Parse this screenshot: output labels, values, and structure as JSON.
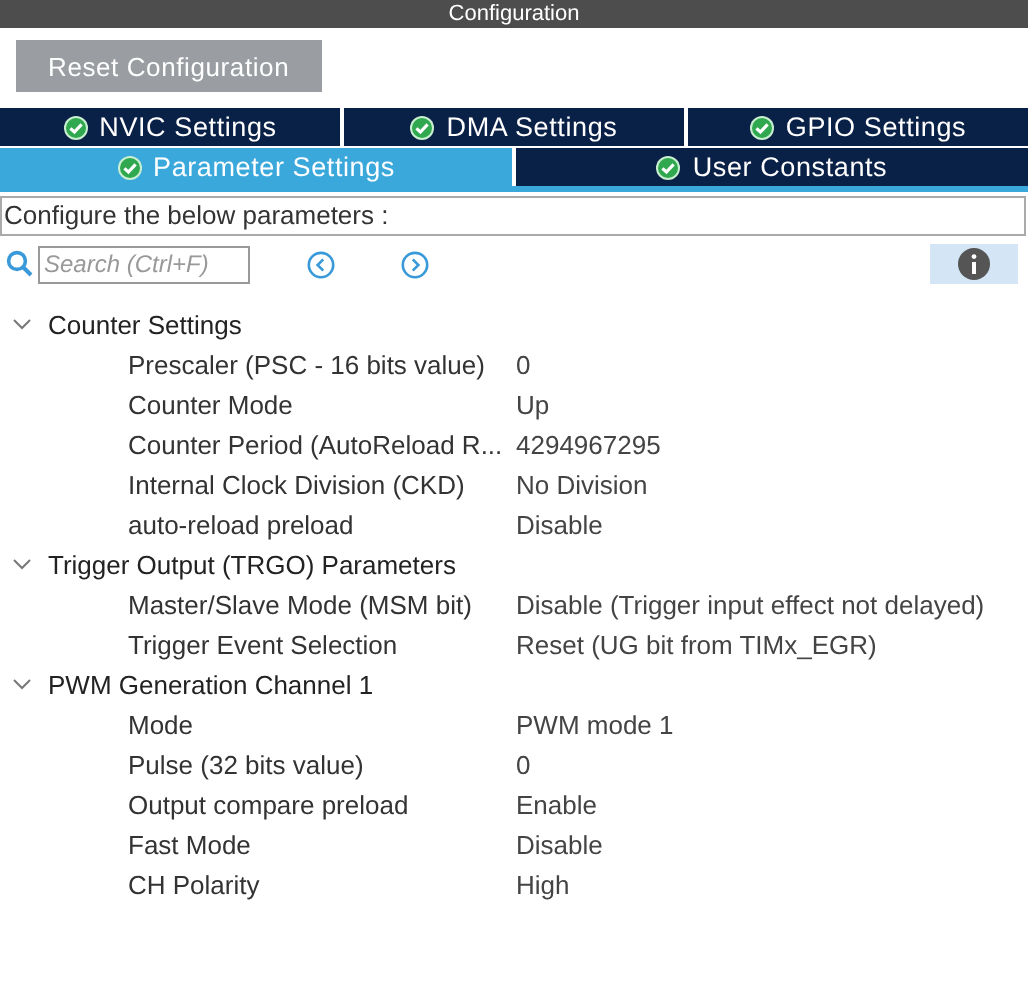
{
  "window": {
    "title": "Configuration"
  },
  "reset_button": "Reset Configuration",
  "tab_rows": [
    [
      {
        "label": "NVIC Settings",
        "selected": false
      },
      {
        "label": "DMA Settings",
        "selected": false
      },
      {
        "label": "GPIO Settings",
        "selected": false
      }
    ],
    [
      {
        "label": "Parameter Settings",
        "selected": true
      },
      {
        "label": "User Constants",
        "selected": false
      }
    ]
  ],
  "description": "Configure the below parameters :",
  "search": {
    "placeholder": "Search (Ctrl+F)"
  },
  "groups": [
    {
      "title": "Counter Settings",
      "expanded": true,
      "params": [
        {
          "name": "Prescaler (PSC - 16 bits value)",
          "value": "0"
        },
        {
          "name": "Counter Mode",
          "value": "Up"
        },
        {
          "name": "Counter Period (AutoReload R...",
          "value": "4294967295"
        },
        {
          "name": "Internal Clock Division (CKD)",
          "value": "No Division"
        },
        {
          "name": "auto-reload preload",
          "value": "Disable"
        }
      ]
    },
    {
      "title": "Trigger Output (TRGO) Parameters",
      "expanded": true,
      "params": [
        {
          "name": "Master/Slave Mode (MSM bit)",
          "value": "Disable (Trigger input effect not delayed)"
        },
        {
          "name": "Trigger Event Selection",
          "value": "Reset (UG bit from TIMx_EGR)"
        }
      ]
    },
    {
      "title": "PWM Generation Channel 1",
      "expanded": true,
      "params": [
        {
          "name": "Mode",
          "value": "PWM mode 1"
        },
        {
          "name": "Pulse (32 bits value)",
          "value": "0"
        },
        {
          "name": "Output compare preload",
          "value": "Enable"
        },
        {
          "name": "Fast Mode",
          "value": "Disable"
        },
        {
          "name": "CH Polarity",
          "value": "High"
        }
      ]
    }
  ]
}
